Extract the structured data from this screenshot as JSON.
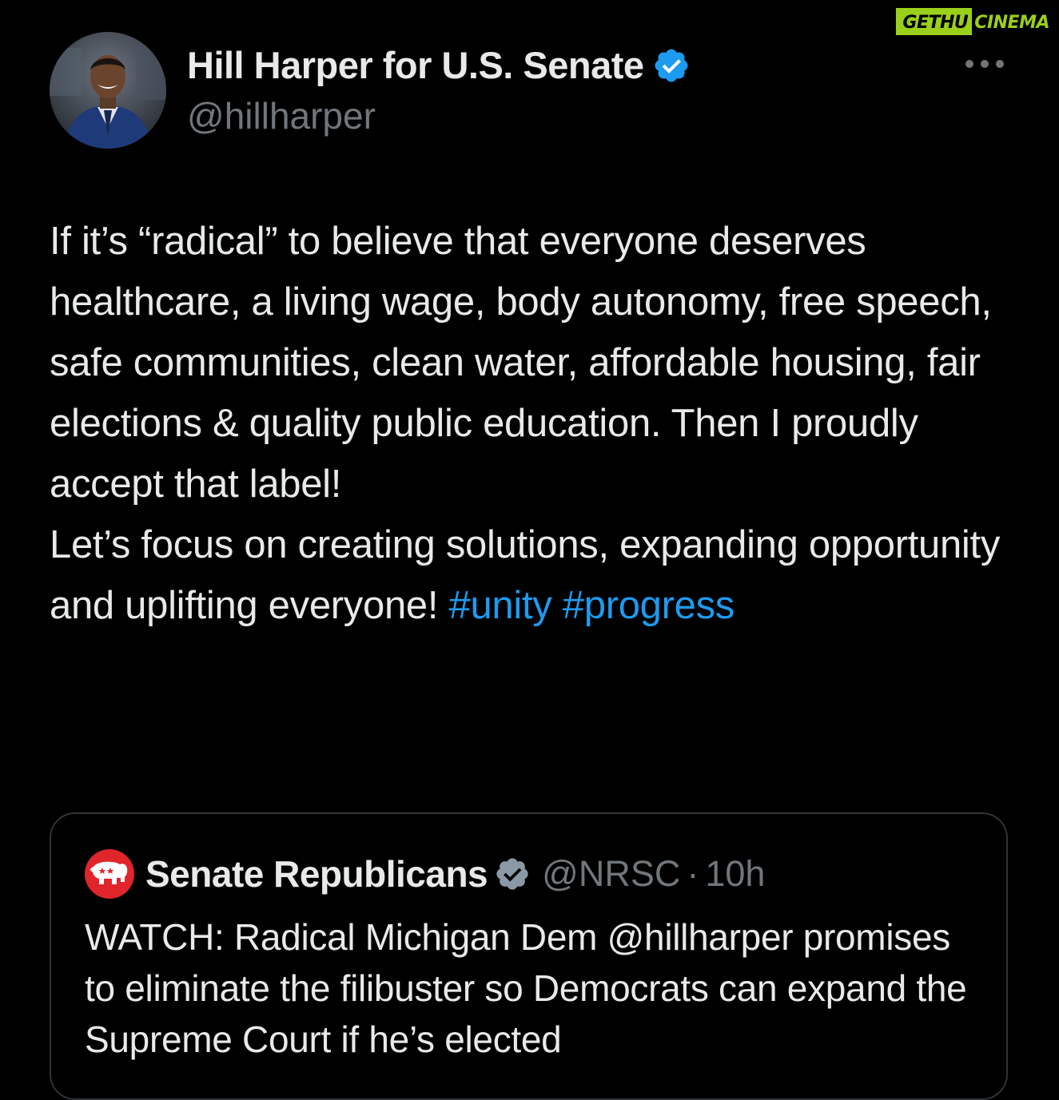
{
  "watermark": {
    "left": "GETHU",
    "right": "CINEMA",
    "color": "#9bd01a"
  },
  "tweet": {
    "display_name": "Hill Harper for U.S. Senate",
    "handle": "@hillharper",
    "verified_icon": "verified-badge-icon",
    "more_icon": "more-options-icon",
    "paragraph1": "If it’s “radical” to believe that everyone deserves healthcare, a living wage, body autonomy, free speech, safe communities, clean water, affordable housing, fair elections & quality public education. Then I proudly accept that label!",
    "paragraph2_text": "Let’s focus on creating solutions, expanding opportunity and uplifting everyone!",
    "hashtags": [
      "#unity",
      "#progress"
    ]
  },
  "quoted_tweet": {
    "display_name": "Senate Republicans",
    "handle": "@NRSC",
    "separator": "·",
    "time": "10h",
    "avatar_icon": "gop-elephant-icon",
    "text": "WATCH: Radical Michigan Dem @hillharper promises to eliminate the filibuster so Democrats can expand the Supreme Court if he’s elected"
  },
  "colors": {
    "background": "#000000",
    "text": "#e7e9ea",
    "muted": "#71767b",
    "link": "#1d9bf0",
    "verified": "#1d9bf0",
    "border": "#2f3336",
    "gop_red": "#e0252b"
  }
}
